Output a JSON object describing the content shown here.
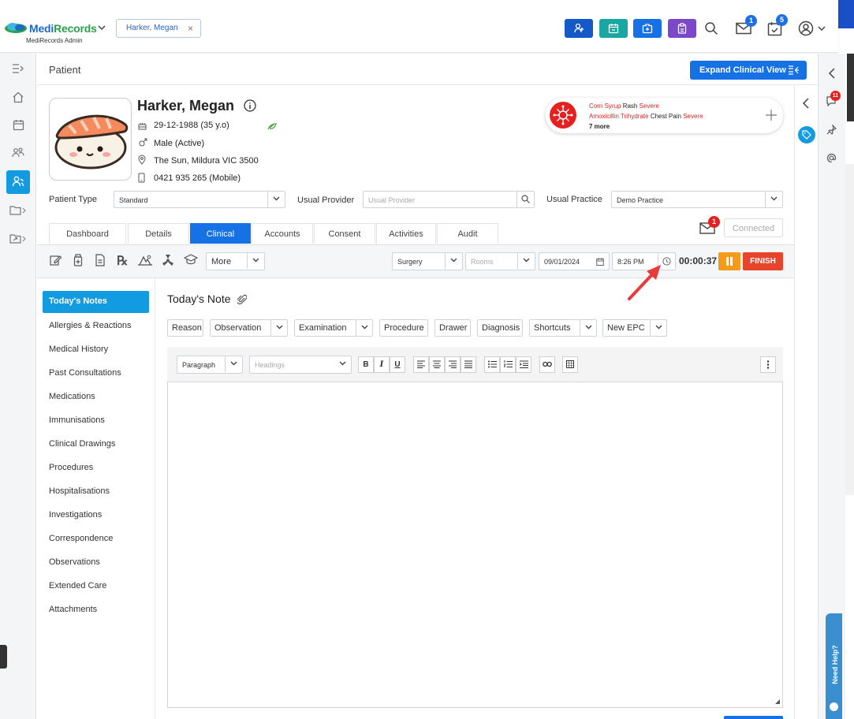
{
  "app": {
    "brand_main": "Medi",
    "brand_accent": "Records",
    "subtitle": "MediRecords Admin",
    "open_patient_chip": "Harker, Megan"
  },
  "header": {
    "mail_badge": "1",
    "tasks_badge": "5",
    "colors": {
      "btn1": "#1558c8",
      "btn2": "#1aa6a3",
      "btn3": "#1671e5",
      "btn4": "#7b49c8"
    }
  },
  "page": {
    "title": "Patient",
    "expand_button": "Expand Clinical View"
  },
  "patient": {
    "name": "Harker, Megan",
    "dob": "29-12-1988 (35 y.o)",
    "gender": "Male (Active)",
    "address": "The Sun, Mildura VIC 3500",
    "phone": "0421 935 265 (Mobile)"
  },
  "allergies": {
    "line1_substance": "Corn Syrup",
    "line1_reaction": "Rash",
    "line1_severity": "Severe",
    "line2_substance": "Amoxicillin Trihydrate",
    "line2_reaction": "Chest Pain",
    "line2_severity": "Severe",
    "more": "7 more"
  },
  "fields": {
    "patient_type_label": "Patient Type",
    "patient_type_value": "Standard",
    "usual_provider_label": "Usual Provider",
    "usual_provider_placeholder": "Usual Provider",
    "usual_practice_label": "Usual Practice",
    "usual_practice_value": "Demo Practice"
  },
  "tabs": [
    "Dashboard",
    "Details",
    "Clinical",
    "Accounts",
    "Consent",
    "Activities",
    "Audit"
  ],
  "messages_badge": "1",
  "connected_label": "Connected",
  "toolbar": {
    "more_label": "More",
    "surgery": "Surgery",
    "rooms_placeholder": "Rooms",
    "date": "09/01/2024",
    "time": "8:26 PM",
    "timer": "00:00:37",
    "finish": "FINISH"
  },
  "sidenav": [
    "Today's Notes",
    "Allergies & Reactions",
    "Medical History",
    "Past Consultations",
    "Medications",
    "Immunisations",
    "Clinical Drawings",
    "Procedures",
    "Hospitalisations",
    "Investigations",
    "Correspondence",
    "Observations",
    "Extended Care",
    "Attachments"
  ],
  "note": {
    "title": "Today's Note",
    "buttons": {
      "reason": "Reason",
      "observation": "Observation",
      "examination": "Examination",
      "procedure": "Procedure",
      "drawer": "Drawer",
      "diagnosis": "Diagnosis",
      "shortcuts": "Shortcuts",
      "new_epc": "New EPC"
    },
    "editor": {
      "paragraph": "Paragraph",
      "headings_placeholder": "Headings",
      "bold": "B",
      "italic": "I",
      "underline": "U"
    }
  },
  "right_rail": {
    "notifications_badge": "11"
  },
  "help": "Need Help?"
}
